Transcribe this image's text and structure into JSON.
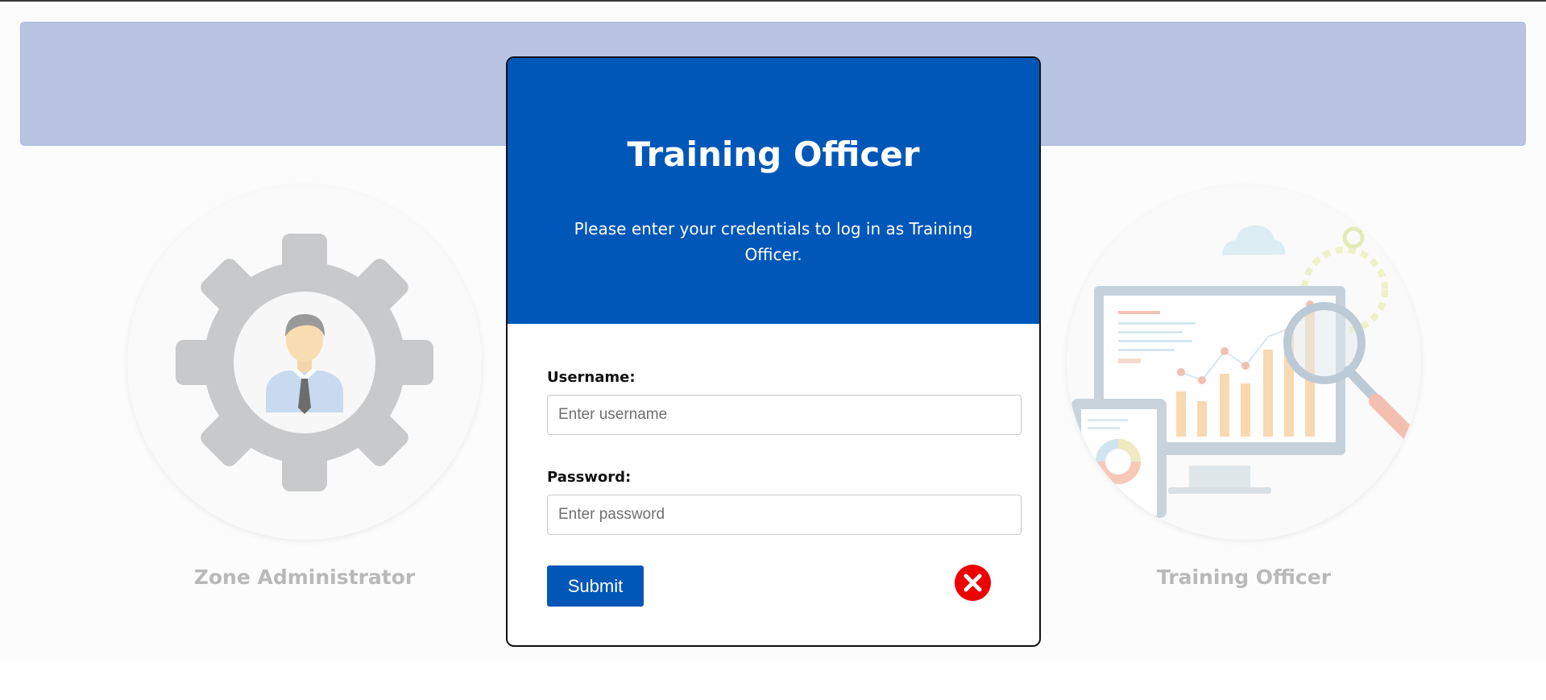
{
  "roles": [
    {
      "label": "Zone Administrator",
      "icon": "admin-gear-person-icon"
    },
    {
      "label": "Training Officer",
      "icon": "analytics-dashboard-icon"
    }
  ],
  "modal": {
    "title": "Training Officer",
    "description": "Please enter your credentials to log in as Training Officer.",
    "username_label": "Username:",
    "username_placeholder": "Enter username",
    "username_value": "",
    "password_label": "Password:",
    "password_placeholder": "Enter password",
    "password_value": "",
    "submit_label": "Submit",
    "close_icon": "close-icon"
  },
  "colors": {
    "primary": "#0057b8",
    "banner": "#b8c4e2",
    "close": "#ee0000"
  }
}
